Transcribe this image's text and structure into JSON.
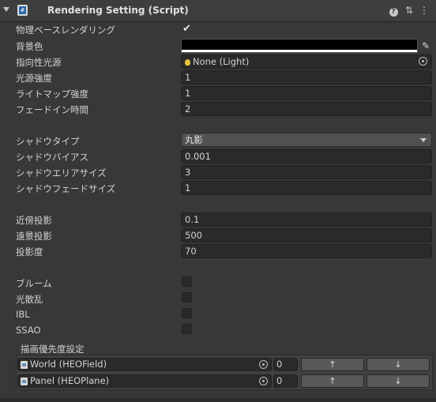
{
  "header": {
    "title": "Rendering Setting (Script)",
    "help_icon": "help-icon",
    "preset_icon": "preset-sliders-icon",
    "menu_icon": "kebab-menu-icon"
  },
  "rows": {
    "physical_rendering": {
      "label": "物理ベースレンダリング",
      "checked": true
    },
    "background_color": {
      "label": "背景色",
      "value": "#000000"
    },
    "directional_light": {
      "label": "指向性光源",
      "value": "None (Light)"
    },
    "light_intensity": {
      "label": "光源強度",
      "value": "1"
    },
    "lightmap_intensity": {
      "label": "ライトマップ強度",
      "value": "1"
    },
    "fade_in_time": {
      "label": "フェードイン時間",
      "value": "2"
    },
    "shadow_type": {
      "label": "シャドウタイプ",
      "value": "丸影"
    },
    "shadow_bias": {
      "label": "シャドウバイアス",
      "value": "0.001"
    },
    "shadow_area_size": {
      "label": "シャドウエリアサイズ",
      "value": "3"
    },
    "shadow_fade_size": {
      "label": "シャドウフェードサイズ",
      "value": "1"
    },
    "near_projection": {
      "label": "近傍投影",
      "value": "0.1"
    },
    "far_projection": {
      "label": "遠景投影",
      "value": "500"
    },
    "projection_angle": {
      "label": "投影度",
      "value": "70"
    },
    "bloom": {
      "label": "ブルーム",
      "checked": false
    },
    "light_scatter": {
      "label": "光散乱",
      "checked": false
    },
    "ibl": {
      "label": "IBL",
      "checked": false
    },
    "ssao": {
      "label": "SSAO",
      "checked": false
    }
  },
  "priority_list": {
    "label": "描画優先度設定",
    "items": [
      {
        "object": "World (HEOField)",
        "value": "0",
        "up": "↑",
        "down": "↓"
      },
      {
        "object": "Panel (HEOPlane)",
        "value": "0",
        "up": "↑",
        "down": "↓"
      }
    ]
  },
  "colors": {
    "background": "#383838",
    "field": "#2a2a2a",
    "button": "#585858",
    "text": "#d2d2d2"
  }
}
